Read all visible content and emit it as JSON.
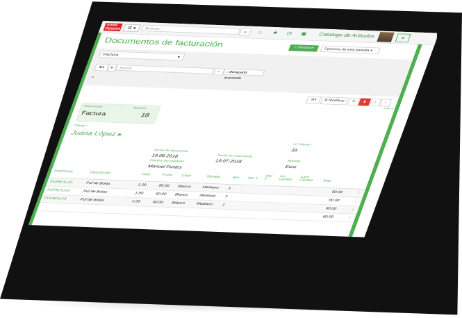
{
  "topbar": {
    "logo_text": "SANS DESIGN",
    "menu_icon": "list-icon",
    "search_placeholder": "Buscar...",
    "catalog_link": "Catálogo de Artículos"
  },
  "page": {
    "title": "Documentos de facturación",
    "introduce_label": "+ Introducir",
    "options_label": "Opciones de esta pantalla"
  },
  "filters": {
    "document_type": "Factura",
    "search_placeholder": "Buscar",
    "advanced_search": "Búsqueda avanzada"
  },
  "actions": {
    "modify": "Modificar",
    "pager": "1 de 3"
  },
  "document": {
    "doc_label": "Documento",
    "doc_value": "Factura",
    "number_label": "Número",
    "number_value": "18",
    "client_label": "Cliente *",
    "client_value": "Juana López",
    "client_number_label": "N.º cliente *",
    "client_number_value": "33",
    "doc_date_label": "Fecha del documento",
    "doc_date_value": "19.06.2018",
    "due_date_label": "Fecha de vencimiento",
    "due_date_value": "19.07.2018",
    "currency_label": "Moneda",
    "currency_value": "Euro",
    "seller_label": "Nombre del vendedor",
    "seller_value": "Manuel Fustes"
  },
  "table": {
    "headers": {
      "ref": "Referencia",
      "desc": "Descripción",
      "qty": "Cant.",
      "price": "P.unit.",
      "color": "Color",
      "size": "Tamaño",
      "alm": "Alm.",
      "dsc1": "Dsc 1",
      "dsc2": "Dsc 2",
      "change": "Un. Cambio",
      "qty_change": "Cant. Cambio",
      "total": "Total"
    },
    "rows": [
      {
        "ref": "PUFBOLAS",
        "desc": "Puf de Bolas",
        "qty": "1.00",
        "price": "60.00",
        "color": "Blanco",
        "size": "Mediano",
        "alm": "1",
        "total": "60.00"
      },
      {
        "ref": "PUFBOLAS",
        "desc": "Puf de Bolas",
        "qty": "1.00",
        "price": "60.00",
        "color": "Blanco",
        "size": "Mediano",
        "alm": "1",
        "total": "60.00"
      },
      {
        "ref": "PUFBOLAS",
        "desc": "Puf de Bolas",
        "qty": "1.00",
        "price": "60.00",
        "color": "Blanco",
        "size": "Mediano",
        "alm": "1",
        "total": "60.00"
      },
      {
        "ref": "",
        "desc": "",
        "qty": "",
        "price": "",
        "color": "",
        "size": "",
        "alm": "",
        "total": "60.00"
      }
    ]
  },
  "colors": {
    "accent": "#4caf50",
    "danger": "#e53935"
  }
}
